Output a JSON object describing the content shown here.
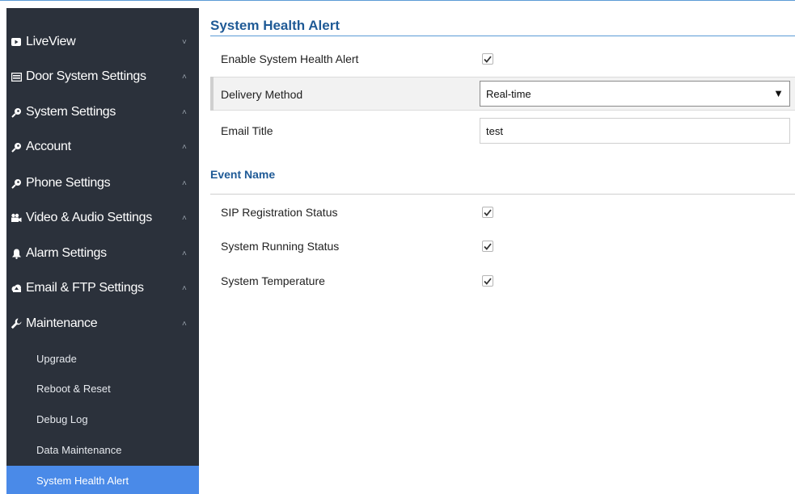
{
  "sidebar": {
    "items": [
      {
        "label": "LiveView",
        "icon": "play-icon",
        "chevron": "˅"
      },
      {
        "label": "Door System Settings",
        "icon": "door-icon",
        "chevron": "˄"
      },
      {
        "label": "System Settings",
        "icon": "key-icon",
        "chevron": "˄"
      },
      {
        "label": "Account",
        "icon": "key-icon",
        "chevron": "˄"
      },
      {
        "label": "Phone Settings",
        "icon": "key-icon",
        "chevron": "˄"
      },
      {
        "label": "Video & Audio Settings",
        "icon": "camera-icon",
        "chevron": "˄"
      },
      {
        "label": "Alarm Settings",
        "icon": "bell-icon",
        "chevron": "˄"
      },
      {
        "label": "Email & FTP Settings",
        "icon": "cloud-icon",
        "chevron": "˄"
      },
      {
        "label": "Maintenance",
        "icon": "wrench-icon",
        "chevron": "˄"
      }
    ],
    "subitems": [
      {
        "label": "Upgrade"
      },
      {
        "label": "Reboot & Reset"
      },
      {
        "label": "Debug Log"
      },
      {
        "label": "Data Maintenance"
      },
      {
        "label": "System Health Alert",
        "active": true
      }
    ],
    "active_color": "#4a8ae8",
    "bg_color": "#2b313b"
  },
  "main": {
    "title": "System Health Alert",
    "enable_label": "Enable System Health Alert",
    "enable_checked": true,
    "delivery_label": "Delivery Method",
    "delivery_value": "Real-time",
    "email_title_label": "Email Title",
    "email_title_value": "test",
    "section_title": "Event Name",
    "events": [
      {
        "label": "SIP Registration Status",
        "checked": true
      },
      {
        "label": "System Running Status",
        "checked": true
      },
      {
        "label": "System Temperature",
        "checked": true
      }
    ],
    "accent_color": "#1f5a96"
  }
}
